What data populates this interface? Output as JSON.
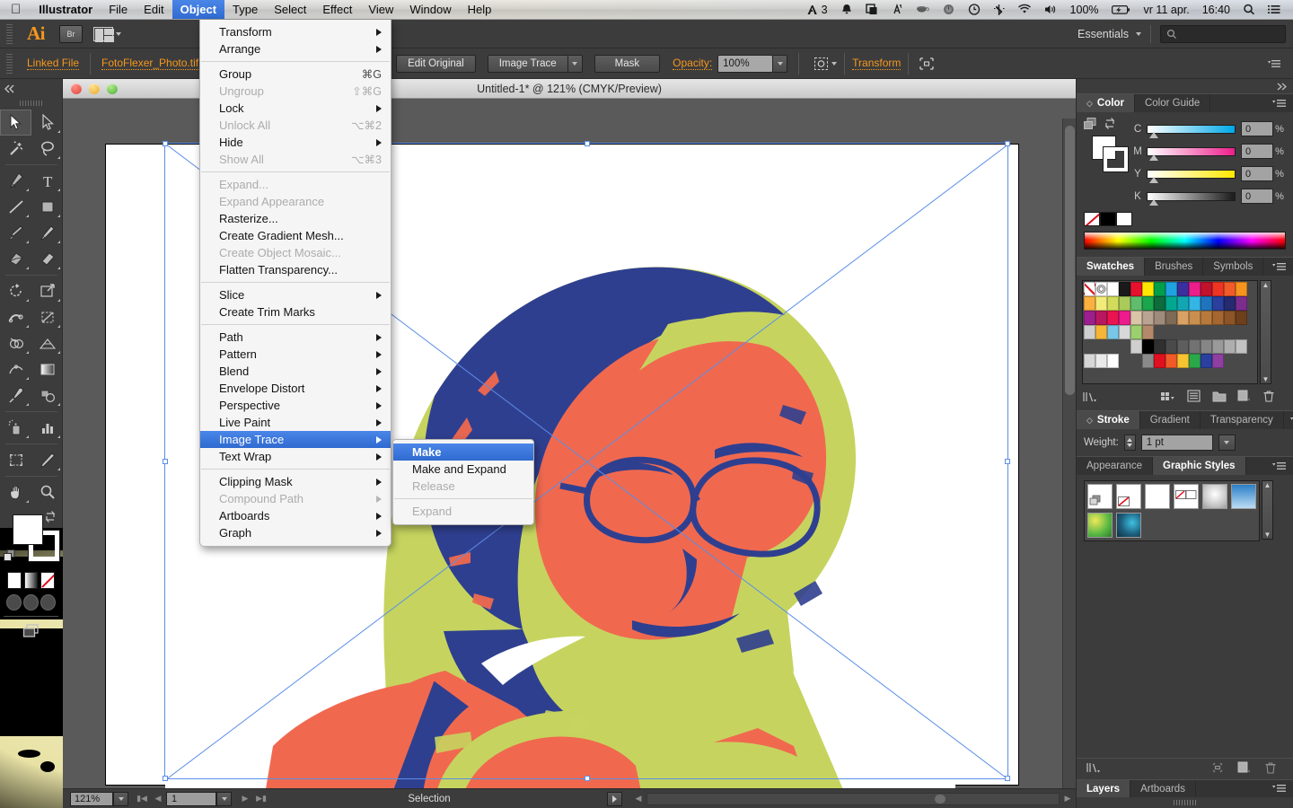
{
  "menubar": {
    "apple": "",
    "app": "Illustrator",
    "items": [
      "File",
      "Edit",
      "Object",
      "Type",
      "Select",
      "Effect",
      "View",
      "Window",
      "Help"
    ],
    "active": "Object",
    "status_right": {
      "notif_count": "3",
      "battery_pct": "100%",
      "date": "vr 11 apr.",
      "time": "16:40"
    }
  },
  "appbar": {
    "logo": "Ai",
    "bridge_label": "Br",
    "workspace": "Essentials",
    "search_placeholder": ""
  },
  "controlbar": {
    "linked_file": "Linked File",
    "filename": "FotoFlexer_Photo.tif",
    "edit_original": "Edit Original",
    "image_trace": "Image Trace",
    "mask": "Mask",
    "opacity_label": "Opacity:",
    "opacity_value": "100%",
    "transform": "Transform"
  },
  "document": {
    "title": "Untitled-1* @ 121% (CMYK/Preview)"
  },
  "statusbar": {
    "zoom": "121%",
    "page": "1",
    "tool_status": "Selection"
  },
  "object_menu": {
    "groups": [
      [
        {
          "label": "Transform",
          "submenu": true,
          "disabled": false,
          "key": ""
        },
        {
          "label": "Arrange",
          "submenu": true,
          "disabled": false,
          "key": ""
        }
      ],
      [
        {
          "label": "Group",
          "submenu": false,
          "disabled": false,
          "key": "⌘G"
        },
        {
          "label": "Ungroup",
          "submenu": false,
          "disabled": true,
          "key": "⇧⌘G"
        },
        {
          "label": "Lock",
          "submenu": true,
          "disabled": false,
          "key": ""
        },
        {
          "label": "Unlock All",
          "submenu": false,
          "disabled": true,
          "key": "⌥⌘2"
        },
        {
          "label": "Hide",
          "submenu": true,
          "disabled": false,
          "key": ""
        },
        {
          "label": "Show All",
          "submenu": false,
          "disabled": true,
          "key": "⌥⌘3"
        }
      ],
      [
        {
          "label": "Expand...",
          "submenu": false,
          "disabled": true,
          "key": ""
        },
        {
          "label": "Expand Appearance",
          "submenu": false,
          "disabled": true,
          "key": ""
        },
        {
          "label": "Rasterize...",
          "submenu": false,
          "disabled": false,
          "key": ""
        },
        {
          "label": "Create Gradient Mesh...",
          "submenu": false,
          "disabled": false,
          "key": ""
        },
        {
          "label": "Create Object Mosaic...",
          "submenu": false,
          "disabled": true,
          "key": ""
        },
        {
          "label": "Flatten Transparency...",
          "submenu": false,
          "disabled": false,
          "key": ""
        }
      ],
      [
        {
          "label": "Slice",
          "submenu": true,
          "disabled": false,
          "key": ""
        },
        {
          "label": "Create Trim Marks",
          "submenu": false,
          "disabled": false,
          "key": ""
        }
      ],
      [
        {
          "label": "Path",
          "submenu": true,
          "disabled": false,
          "key": ""
        },
        {
          "label": "Pattern",
          "submenu": true,
          "disabled": false,
          "key": ""
        },
        {
          "label": "Blend",
          "submenu": true,
          "disabled": false,
          "key": ""
        },
        {
          "label": "Envelope Distort",
          "submenu": true,
          "disabled": false,
          "key": ""
        },
        {
          "label": "Perspective",
          "submenu": true,
          "disabled": false,
          "key": ""
        },
        {
          "label": "Live Paint",
          "submenu": true,
          "disabled": false,
          "key": ""
        },
        {
          "label": "Image Trace",
          "submenu": true,
          "disabled": false,
          "key": "",
          "highlighted": true
        },
        {
          "label": "Text Wrap",
          "submenu": true,
          "disabled": false,
          "key": ""
        }
      ],
      [
        {
          "label": "Clipping Mask",
          "submenu": true,
          "disabled": false,
          "key": ""
        },
        {
          "label": "Compound Path",
          "submenu": true,
          "disabled": true,
          "key": ""
        },
        {
          "label": "Artboards",
          "submenu": true,
          "disabled": false,
          "key": ""
        },
        {
          "label": "Graph",
          "submenu": true,
          "disabled": false,
          "key": ""
        }
      ]
    ]
  },
  "image_trace_submenu": {
    "items": [
      {
        "label": "Make",
        "disabled": false,
        "highlighted": true
      },
      {
        "label": "Make and Expand",
        "disabled": false,
        "highlighted": false
      },
      {
        "label": "Release",
        "disabled": true,
        "highlighted": false
      }
    ],
    "items2": [
      {
        "label": "Expand",
        "disabled": true,
        "highlighted": false
      }
    ]
  },
  "panels": {
    "color": {
      "tabs": [
        "Color",
        "Color Guide"
      ],
      "active_tab": "Color",
      "channels": [
        {
          "name": "C",
          "value": "0",
          "unit": "%",
          "color": "#00a8e8"
        },
        {
          "name": "M",
          "value": "0",
          "unit": "%",
          "color": "#ec1e8c"
        },
        {
          "name": "Y",
          "value": "0",
          "unit": "%",
          "color": "#ffe800"
        },
        {
          "name": "K",
          "value": "0",
          "unit": "%",
          "color": "#1a1a1a"
        }
      ]
    },
    "swatches": {
      "tabs": [
        "Swatches",
        "Brushes",
        "Symbols"
      ],
      "active_tab": "Swatches",
      "colors_row1": [
        "#ffffff",
        "#cfcfcf",
        "#ffffff",
        "#1a1a1a",
        "#e8112d",
        "#ffe800",
        "#00a04a",
        "#1fa3e0",
        "#3b2f9e",
        "#ec1e8c",
        "#c1122b",
        "#ee3524",
        "#f15a29",
        "#f7941e",
        "#fbb040"
      ],
      "colors_row2": [
        "#f2eb7a",
        "#d2dc5a",
        "#aacb5a",
        "#5fbd6e",
        "#1aa64b",
        "#0d6b3c",
        "#00a88f",
        "#12a6b3",
        "#33b5e5",
        "#1f74bd",
        "#2a3f9e",
        "#262a6e",
        "#7b2d8e",
        "#9c1f8f",
        "#b8185f"
      ],
      "colors_row3": [
        "#ec1351",
        "#ed1b8d",
        "#d9c5a8",
        "#b9a392",
        "#9e8b7a",
        "#7d6a57",
        "#d9a264",
        "#c98f4e",
        "#b87a3c",
        "#a5672f",
        "#8c5427",
        "#6e3f1c",
        "#cfcfcf",
        "#f5b63a",
        "#78c7e8"
      ],
      "colors_row4": [
        "#d8d8d8",
        "#9bcf6f",
        "#b4886b"
      ],
      "grays": [
        "#cfcfcf",
        "#000000",
        "#303030",
        "#4a4a4a",
        "#5e5e5e",
        "#727272",
        "#868686",
        "#9a9a9a",
        "#aeaeae",
        "#c2c2c2",
        "#d6d6d6",
        "#eaeaea",
        "#ffffff"
      ],
      "colors_row6": [
        "#8a8a8a",
        "#e01020",
        "#f15a29",
        "#f7c331",
        "#2ba84a",
        "#2a3f9e",
        "#8e3fa0"
      ]
    },
    "stroke": {
      "tabs": [
        "Stroke",
        "Gradient",
        "Transparency"
      ],
      "active_tab": "Stroke",
      "weight_label": "Weight:",
      "weight_value": "1 pt"
    },
    "graphic_styles": {
      "tabs": [
        "Appearance",
        "Graphic Styles"
      ],
      "active_tab": "Graphic Styles"
    },
    "layers": {
      "tabs": [
        "Layers",
        "Artboards"
      ],
      "active_tab": "Layers"
    }
  },
  "toolbox": {
    "tools": [
      "selection-tool",
      "direct-selection-tool",
      "magic-wand-tool",
      "lasso-tool",
      "pen-tool",
      "type-tool",
      "line-segment-tool",
      "rectangle-tool",
      "paintbrush-tool",
      "pencil-tool",
      "blob-brush-tool",
      "eraser-tool",
      "rotate-tool",
      "scale-tool",
      "width-tool",
      "free-transform-tool",
      "shape-builder-tool",
      "perspective-grid-tool",
      "mesh-tool",
      "gradient-tool",
      "eyedropper-tool",
      "blend-tool",
      "symbol-sprayer-tool",
      "column-graph-tool",
      "artboard-tool",
      "slice-tool",
      "hand-tool",
      "zoom-tool"
    ],
    "selected": "selection-tool"
  },
  "artwork": {
    "palette": {
      "orange": "#f0694f",
      "blue": "#2f3f8f",
      "green": "#c6d45f",
      "white": "#ffffff"
    }
  }
}
